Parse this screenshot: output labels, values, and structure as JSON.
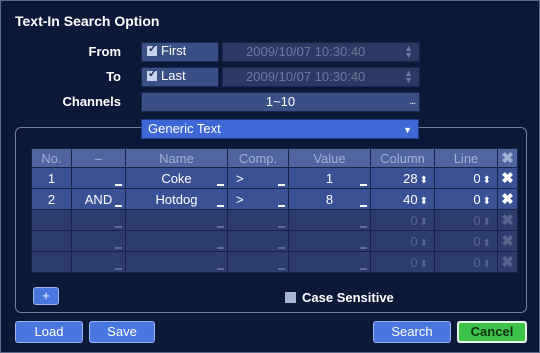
{
  "dialog": {
    "title": "Text-In Search Option"
  },
  "from": {
    "label": "From",
    "checkbox_label": "First",
    "checked": true,
    "datetime": "2009/10/07  10:30:40"
  },
  "to": {
    "label": "To",
    "checkbox_label": "Last",
    "checked": true,
    "datetime": "2009/10/07  10:30:40"
  },
  "channels": {
    "label": "Channels",
    "value": "1~10",
    "browse": "..."
  },
  "text_type": {
    "selected": "Generic Text"
  },
  "table": {
    "headers": [
      "No.",
      "–",
      "Name",
      "Comp.",
      "Value",
      "Column",
      "Line"
    ],
    "rows": [
      {
        "no": "1",
        "op": "",
        "name": "Coke",
        "comp": ">",
        "value": "1",
        "column": "28",
        "line": "0"
      },
      {
        "no": "2",
        "op": "AND",
        "name": "Hotdog",
        "comp": ">",
        "value": "8",
        "column": "40",
        "line": "0"
      }
    ],
    "empty_defaults": {
      "column": "0",
      "line": "0"
    }
  },
  "add_button": "+",
  "case_sensitive": {
    "label": "Case Sensitive",
    "checked": false
  },
  "buttons": {
    "load": "Load",
    "save": "Save",
    "search": "Search",
    "cancel": "Cancel"
  },
  "icons": {
    "delete": "close-x-icon",
    "spin": "up-down-arrows-icon"
  },
  "colors": {
    "background": "#0b1838",
    "accent": "#4a76e0",
    "cancel": "#3ec34a"
  }
}
